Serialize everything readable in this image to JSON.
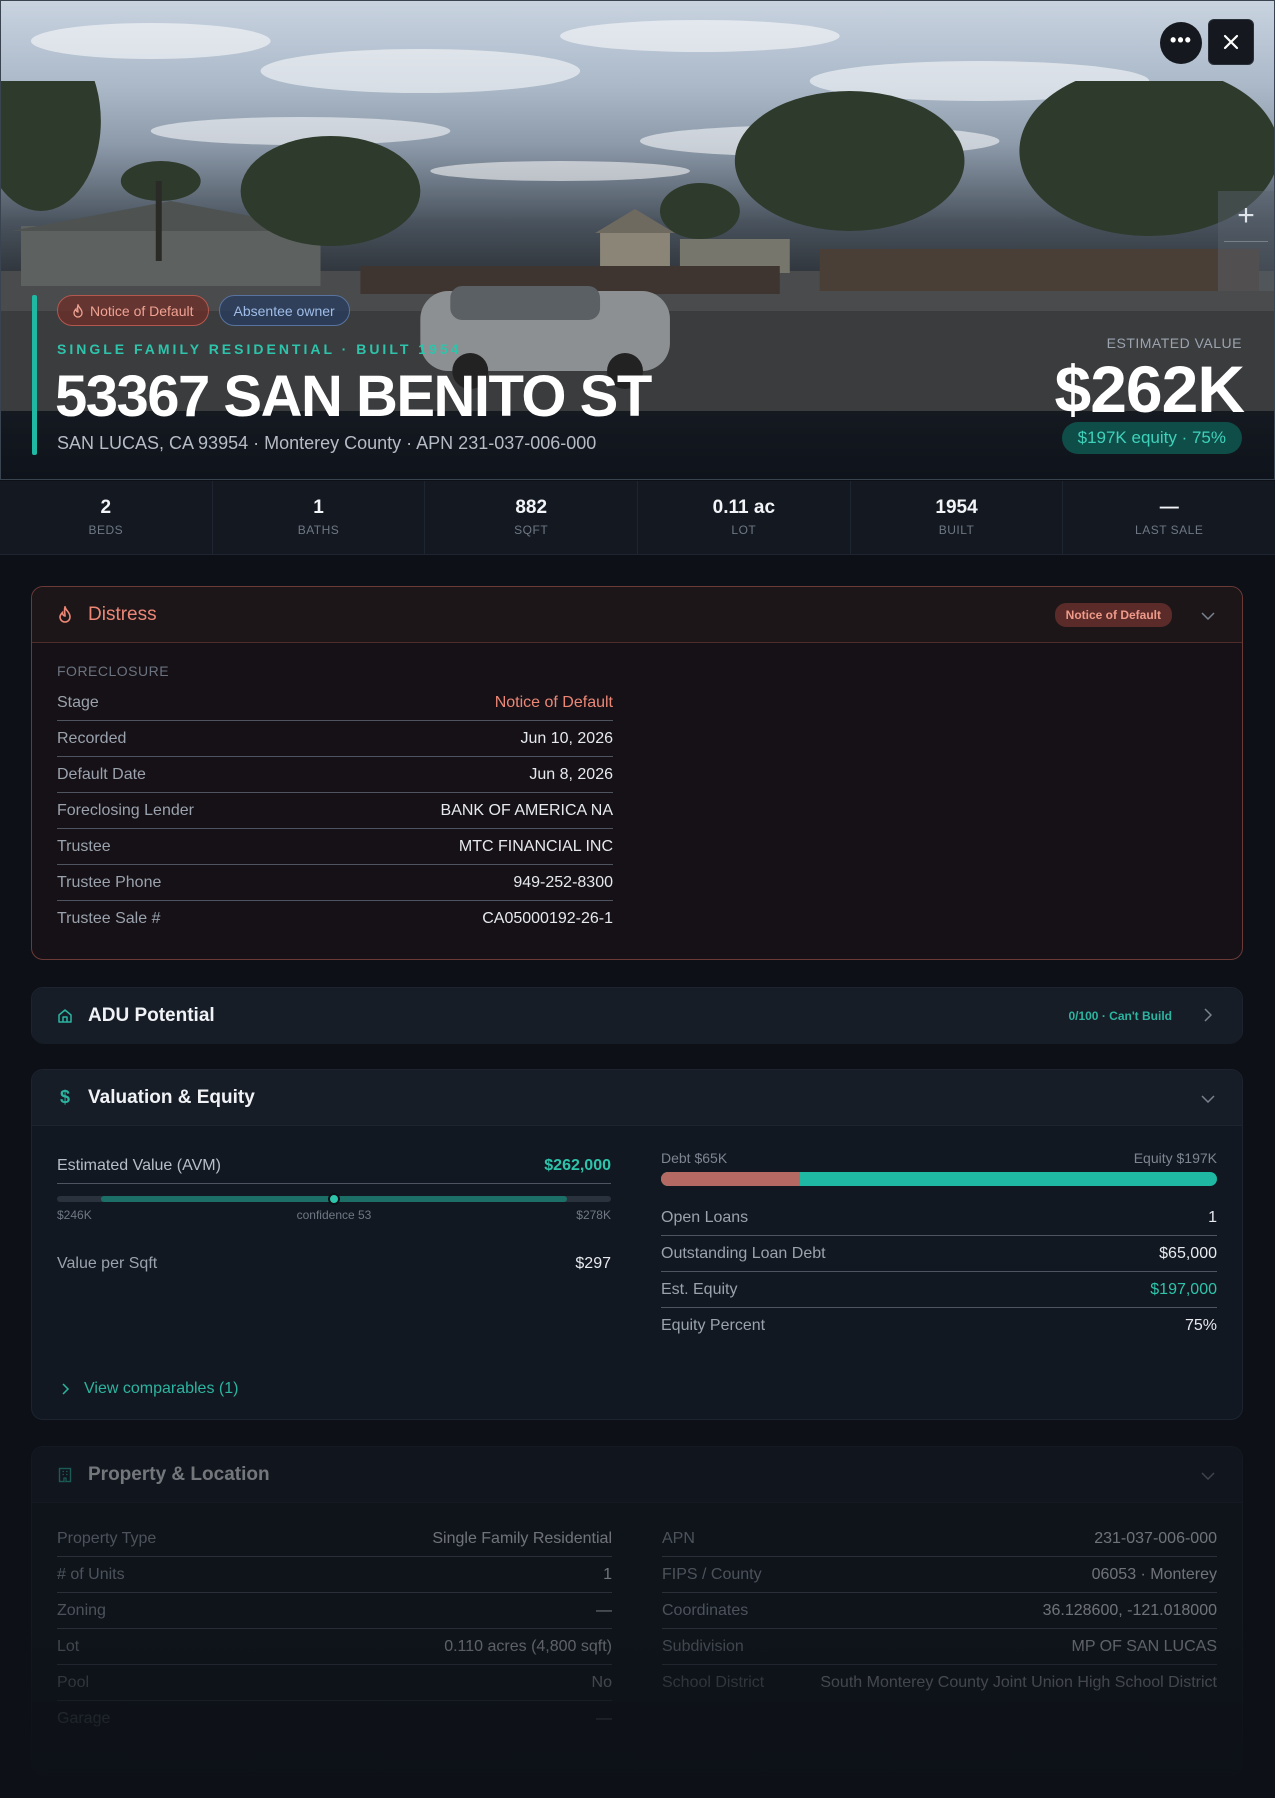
{
  "hero": {
    "tags": [
      "Notice of Default",
      "Absentee owner"
    ],
    "subtitle": "SINGLE FAMILY RESIDENTIAL · BUILT 1954",
    "address": "53367 SAN BENITO ST",
    "location_line": "SAN LUCAS, CA 93954 · Monterey County · APN 231-037-006-000",
    "estimated_value_label": "ESTIMATED VALUE",
    "estimated_value": "$262K",
    "equity_pill": "$197K equity · 75%",
    "more_icon": "more-horizontal-icon",
    "close_icon": "close-icon",
    "zoom_in_label": "+"
  },
  "stats": [
    {
      "value": "2",
      "label": "BEDS"
    },
    {
      "value": "1",
      "label": "BATHS"
    },
    {
      "value": "882",
      "label": "SQFT"
    },
    {
      "value": "0.11 ac",
      "label": "LOT"
    },
    {
      "value": "1954",
      "label": "BUILT"
    },
    {
      "value": "—",
      "label": "LAST SALE"
    }
  ],
  "distress": {
    "title": "Distress",
    "badge": "Notice of Default",
    "section_label": "FORECLOSURE",
    "rows": [
      {
        "k": "Stage",
        "v": "Notice of Default"
      },
      {
        "k": "Recorded",
        "v": "Jun 10, 2026"
      },
      {
        "k": "Default Date",
        "v": "Jun 8, 2026"
      },
      {
        "k": "Foreclosing Lender",
        "v": "BANK OF AMERICA NA"
      },
      {
        "k": "Trustee",
        "v": "MTC FINANCIAL INC"
      },
      {
        "k": "Trustee Phone",
        "v": "949-252-8300"
      },
      {
        "k": "Trustee Sale #",
        "v": "CA05000192-26-1"
      }
    ]
  },
  "adu": {
    "title": "ADU Potential",
    "badge": "0/100 · Can't Build"
  },
  "valuation": {
    "title": "Valuation & Equity",
    "avm_label": "Estimated Value (AVM)",
    "avm_value": "$262,000",
    "range_low": "$246K",
    "range_high": "$278K",
    "confidence": "confidence 53",
    "avm_position_fraction": 0.5,
    "per_sqft_label": "Value per Sqft",
    "per_sqft_value": "$297",
    "debt_label": "Debt $65K",
    "equity_label": "Equity $197K",
    "debt_fraction": 0.25,
    "rows": [
      {
        "k": "Open Loans",
        "v": "1"
      },
      {
        "k": "Outstanding Loan Debt",
        "v": "$65,000"
      },
      {
        "k": "Est. Equity",
        "v": "$197,000"
      },
      {
        "k": "Equity Percent",
        "v": "75%"
      }
    ],
    "comparables_link": "View comparables (1)"
  },
  "property": {
    "title": "Property & Location",
    "left_rows": [
      {
        "k": "Property Type",
        "v": "Single Family Residential"
      },
      {
        "k": "# of Units",
        "v": "1"
      },
      {
        "k": "Zoning",
        "v": "—"
      },
      {
        "k": "Lot",
        "v": "0.110 acres (4,800 sqft)"
      },
      {
        "k": "Pool",
        "v": "No"
      },
      {
        "k": "Garage",
        "v": "—"
      }
    ],
    "right_rows": [
      {
        "k": "APN",
        "v": "231-037-006-000"
      },
      {
        "k": "FIPS / County",
        "v": "06053 · Monterey"
      },
      {
        "k": "Coordinates",
        "v": "36.128600, -121.018000"
      },
      {
        "k": "Subdivision",
        "v": "MP OF SAN LUCAS"
      },
      {
        "k": "School District",
        "v": "South Monterey County Joint Union High School District"
      }
    ]
  },
  "colors": {
    "accent": "#1fb8a3",
    "danger": "#ec8776",
    "debt": "#b46a62"
  }
}
